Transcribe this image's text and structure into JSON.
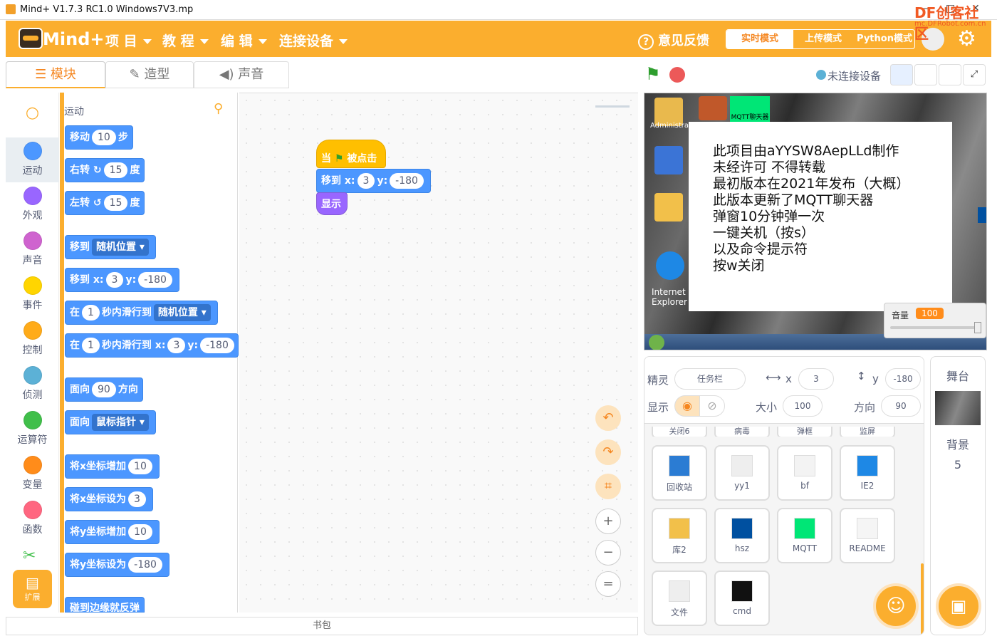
{
  "window": {
    "title": "Mind+ V1.7.3 RC1.0   Windows7V3.mp",
    "minimize": "—",
    "maximize": "□",
    "close": "✕"
  },
  "menubar": {
    "logo": "Mind+",
    "items": [
      "项 目",
      "教 程",
      "编 辑",
      "连接设备"
    ],
    "feedback": "意见反馈",
    "modes": [
      "实时模式",
      "上传模式",
      "Python模式"
    ],
    "active_mode": "实时模式",
    "watermark": "DF创客社区",
    "watermark_url": "mc.DFRobot.com.cn"
  },
  "tabs": [
    "模块",
    "造型",
    "声音"
  ],
  "categories": [
    {
      "label": "运动",
      "color": "#4c97ff"
    },
    {
      "label": "外观",
      "color": "#9966ff"
    },
    {
      "label": "声音",
      "color": "#cf63cf"
    },
    {
      "label": "事件",
      "color": "#ffd500"
    },
    {
      "label": "控制",
      "color": "#ffab19"
    },
    {
      "label": "侦测",
      "color": "#5cb1d6"
    },
    {
      "label": "运算符",
      "color": "#40bf4a"
    },
    {
      "label": "变量",
      "color": "#ff8c1a"
    },
    {
      "label": "函数",
      "color": "#ff6680"
    }
  ],
  "extension_label": "扩展",
  "palette": {
    "title": "运动",
    "blocks": {
      "move": [
        "移动",
        "10",
        "步"
      ],
      "turn_right": [
        "右转",
        "↻",
        "15",
        "度"
      ],
      "turn_left": [
        "左转",
        "↺",
        "15",
        "度"
      ],
      "goto": [
        "移到",
        "随机位置 ▾"
      ],
      "goto_xy": [
        "移到 x:",
        "3",
        "y:",
        "-180"
      ],
      "glide_to": [
        "在",
        "1",
        "秒内滑行到",
        "随机位置 ▾"
      ],
      "glide_xy": [
        "在",
        "1",
        "秒内滑行到 x:",
        "3",
        "y:",
        "-180"
      ],
      "point_dir": [
        "面向",
        "90",
        "方向"
      ],
      "point_towards": [
        "面向",
        "鼠标指针 ▾"
      ],
      "change_x": [
        "将x坐标增加",
        "10"
      ],
      "set_x": [
        "将x坐标设为",
        "3"
      ],
      "change_y": [
        "将y坐标增加",
        "10"
      ],
      "set_y": [
        "将y坐标设为",
        "-180"
      ],
      "bounce": [
        "碰到边缘就反弹"
      ]
    }
  },
  "script": {
    "hat": [
      "当",
      "被点击"
    ],
    "goto": [
      "移到 x:",
      "3",
      "y:",
      "-180"
    ],
    "show": "显示"
  },
  "zoom": {
    "undo": "↶",
    "redo": "↷",
    "crop": "⌗",
    "zoom_in": "+",
    "zoom_out": "−",
    "reset": "="
  },
  "bookbar": "书包",
  "stage_header": {
    "status": "未连接设备"
  },
  "stage_popup": [
    "此项目由aYYSW8AepLLd制作",
    "未经许可 不得转载",
    "最初版本在2021年发布（大概）",
    "此版本更新了MQTT聊天器",
    "弹窗10分钟弹一次",
    "一键关机（按s）",
    "以及命令提示符",
    "按w关闭"
  ],
  "desktop_labels": {
    "admin": "Administrat",
    "ie": "Internet Explorer",
    "mqtt": "MQTT聊天器"
  },
  "volume": {
    "label": "音量",
    "value": "100",
    "level": 1.0
  },
  "sprite_info": {
    "sprite_label": "精灵",
    "sprite_name": "任务栏",
    "x_label": "x",
    "x": "3",
    "y_label": "y",
    "y": "-180",
    "show_label": "显示",
    "size_label": "大小",
    "size": "100",
    "dir_label": "方向",
    "dir": "90"
  },
  "sprites_partial": [
    "关闭6",
    "病毒",
    "弹框",
    "监屏"
  ],
  "sprites": [
    {
      "name": "回收站",
      "color": "#2b7cd3"
    },
    {
      "name": "yy1",
      "color": "#eeeeee"
    },
    {
      "name": "bf",
      "color": "#f3f3f3"
    },
    {
      "name": "IE2",
      "color": "#1e88e5"
    },
    {
      "name": "库2",
      "color": "#f2c04a"
    },
    {
      "name": "hsz",
      "color": "#0050a0"
    },
    {
      "name": "MQTT",
      "color": "#00e676"
    },
    {
      "name": "README",
      "color": "#f5f5f5"
    },
    {
      "name": "文件",
      "color": "#eeeeee"
    },
    {
      "name": "cmd",
      "color": "#111111"
    }
  ],
  "stage_panel": {
    "title": "舞台",
    "bg_label": "背景",
    "bg_count": "5"
  }
}
